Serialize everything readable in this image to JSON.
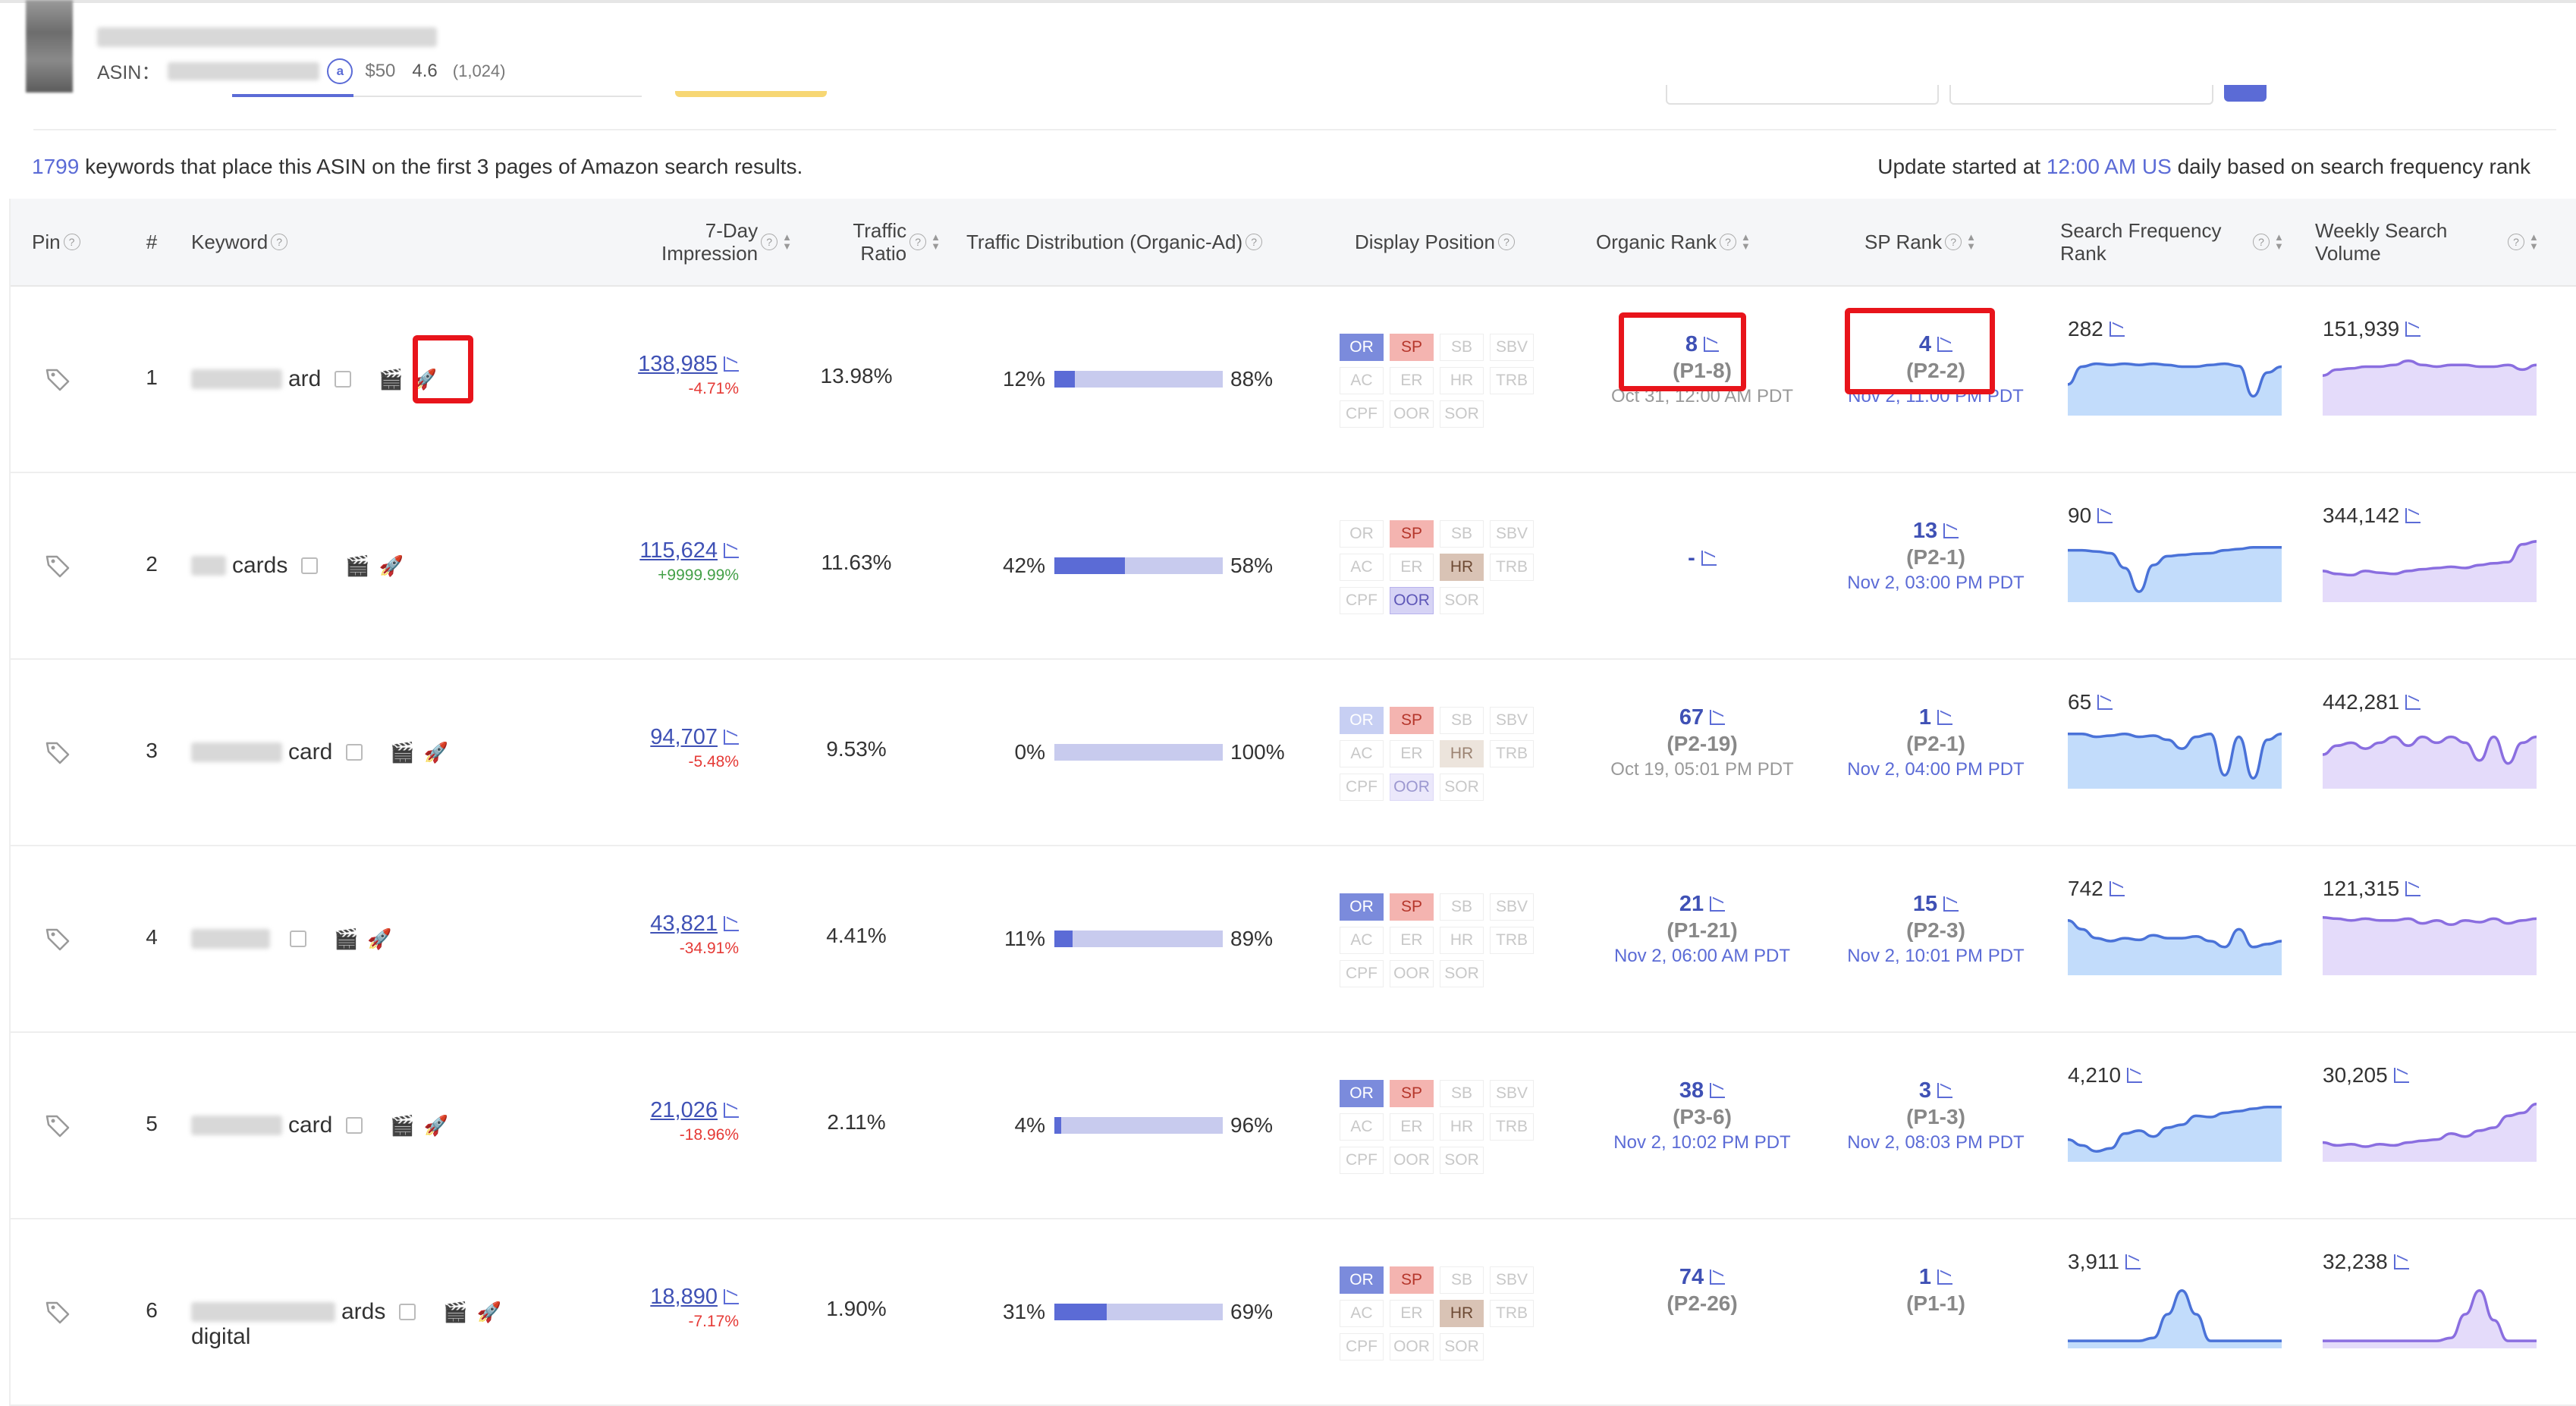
{
  "product": {
    "asin_label": "ASIN：",
    "amazon_icon": "a",
    "price": "$50",
    "rating": "4.6",
    "reviews": "(1,024)"
  },
  "summary": {
    "count": "1799",
    "text": " keywords that place this ASIN on the first 3 pages of Amazon search results.",
    "update_prefix": "Update started at ",
    "update_time": "12:00 AM US",
    "update_suffix": " daily based on search frequency rank"
  },
  "columns": {
    "pin": "Pin",
    "num": "#",
    "keyword": "Keyword",
    "impression": "7-Day Impression",
    "traffic_ratio": "Traffic Ratio",
    "distribution": "Traffic Distribution (Organic-Ad)",
    "display": "Display Position",
    "organic_rank": "Organic Rank",
    "sp_rank": "SP Rank",
    "sfr": "Search Frequency Rank",
    "wsv": "Weekly Search Volume"
  },
  "badge_labels": [
    "OR",
    "SP",
    "SB",
    "SBV",
    "AC",
    "ER",
    "HR",
    "TRB",
    "CPF",
    "OOR",
    "SOR"
  ],
  "rows": [
    {
      "num": "1",
      "kw_tail": "ard",
      "impression": "138,985",
      "change": "-4.71%",
      "change_dir": "neg",
      "ratio": "13.98%",
      "org": "12%",
      "ad": "88%",
      "org_frac": 0.12,
      "badges": {
        "OR": "OR",
        "SP": "SP",
        "HR": "",
        "OOR": ""
      },
      "organic": {
        "v": "8",
        "p": "(P1-8)",
        "d": "Oct 31, 12:00 AM PDT",
        "dc": "gray"
      },
      "sp": {
        "v": "4",
        "p": "(P2-2)",
        "d": "Nov 2, 11:00 PM PDT",
        "dc": "blue"
      },
      "sfr": "282",
      "wsv": "151,939",
      "sfr_series": [
        0.55,
        0.25,
        0.2,
        0.22,
        0.2,
        0.22,
        0.2,
        0.22,
        0.25,
        0.25,
        0.22,
        0.2,
        0.24,
        0.75,
        0.35,
        0.25
      ],
      "wsv_series": [
        0.4,
        0.3,
        0.28,
        0.25,
        0.25,
        0.22,
        0.15,
        0.22,
        0.25,
        0.22,
        0.22,
        0.25,
        0.25,
        0.22,
        0.3,
        0.22
      ]
    },
    {
      "num": "2",
      "kw_tail": "cards",
      "impression": "115,624",
      "change": "+9999.99%",
      "change_dir": "pos",
      "ratio": "11.63%",
      "org": "42%",
      "ad": "58%",
      "org_frac": 0.42,
      "badges": {
        "OR": "",
        "SP": "SP",
        "HR": "HR",
        "OOR": "OOR"
      },
      "organic": {
        "v": "-",
        "p": "",
        "d": "",
        "dc": "gray"
      },
      "sp": {
        "v": "13",
        "p": "(P2-1)",
        "d": "Nov 2, 03:00 PM PDT",
        "dc": "blue"
      },
      "sfr": "90",
      "wsv": "344,142",
      "sfr_series": [
        0.2,
        0.2,
        0.22,
        0.25,
        0.5,
        0.9,
        0.45,
        0.3,
        0.28,
        0.26,
        0.25,
        0.2,
        0.18,
        0.15,
        0.15,
        0.15
      ],
      "wsv_series": [
        0.55,
        0.6,
        0.62,
        0.55,
        0.58,
        0.6,
        0.55,
        0.52,
        0.5,
        0.48,
        0.5,
        0.45,
        0.42,
        0.4,
        0.1,
        0.05
      ]
    },
    {
      "num": "3",
      "kw_tail": "card",
      "impression": "94,707",
      "change": "-5.48%",
      "change_dir": "neg",
      "ratio": "9.53%",
      "org": "0%",
      "ad": "100%",
      "org_frac": 0.0,
      "badges": {
        "OR": "ORl",
        "SP": "SP",
        "HR": "HRl",
        "OOR": "OORl"
      },
      "organic": {
        "v": "67",
        "p": "(P2-19)",
        "d": "Oct 19, 05:01 PM PDT",
        "dc": "gray"
      },
      "sp": {
        "v": "1",
        "p": "(P2-1)",
        "d": "Nov 2, 04:00 PM PDT",
        "dc": "blue"
      },
      "sfr": "65",
      "wsv": "442,281",
      "sfr_series": [
        0.15,
        0.15,
        0.2,
        0.18,
        0.15,
        0.2,
        0.18,
        0.25,
        0.4,
        0.2,
        0.15,
        0.85,
        0.2,
        0.9,
        0.25,
        0.15
      ],
      "wsv_series": [
        0.5,
        0.35,
        0.3,
        0.4,
        0.3,
        0.2,
        0.35,
        0.2,
        0.3,
        0.2,
        0.3,
        0.6,
        0.2,
        0.65,
        0.3,
        0.2
      ]
    },
    {
      "num": "4",
      "kw_tail": "",
      "impression": "43,821",
      "change": "-34.91%",
      "change_dir": "neg",
      "ratio": "4.41%",
      "org": "11%",
      "ad": "89%",
      "org_frac": 0.11,
      "badges": {
        "OR": "OR",
        "SP": "SP",
        "HR": "",
        "OOR": ""
      },
      "organic": {
        "v": "21",
        "p": "(P1-21)",
        "d": "Nov 2, 06:00 AM PDT",
        "dc": "blue"
      },
      "sp": {
        "v": "15",
        "p": "(P2-3)",
        "d": "Nov 2, 10:01 PM PDT",
        "dc": "blue"
      },
      "sfr": "742",
      "wsv": "121,315",
      "sfr_series": [
        0.15,
        0.3,
        0.45,
        0.5,
        0.45,
        0.48,
        0.4,
        0.45,
        0.45,
        0.42,
        0.5,
        0.6,
        0.3,
        0.6,
        0.55,
        0.5
      ],
      "wsv_series": [
        0.1,
        0.12,
        0.15,
        0.12,
        0.15,
        0.15,
        0.12,
        0.2,
        0.15,
        0.22,
        0.15,
        0.18,
        0.12,
        0.2,
        0.15,
        0.12
      ]
    },
    {
      "num": "5",
      "kw_tail": "card",
      "impression": "21,026",
      "change": "-18.96%",
      "change_dir": "neg",
      "ratio": "2.11%",
      "org": "4%",
      "ad": "96%",
      "org_frac": 0.04,
      "badges": {
        "OR": "OR",
        "SP": "SP",
        "HR": "",
        "OOR": ""
      },
      "organic": {
        "v": "38",
        "p": "(P3-6)",
        "d": "Nov 2, 10:02 PM PDT",
        "dc": "blue"
      },
      "sp": {
        "v": "3",
        "p": "(P1-3)",
        "d": "Nov 2, 08:03 PM PDT",
        "dc": "blue"
      },
      "sfr": "4,210",
      "wsv": "30,205",
      "sfr_series": [
        0.7,
        0.8,
        0.9,
        0.85,
        0.6,
        0.55,
        0.65,
        0.5,
        0.45,
        0.3,
        0.32,
        0.25,
        0.22,
        0.18,
        0.15,
        0.15
      ],
      "wsv_series": [
        0.75,
        0.8,
        0.78,
        0.82,
        0.78,
        0.8,
        0.75,
        0.72,
        0.7,
        0.6,
        0.65,
        0.55,
        0.5,
        0.3,
        0.25,
        0.1
      ]
    },
    {
      "num": "6",
      "kw_tail": "ards",
      "kw_second": "digital",
      "impression": "18,890",
      "change": "-7.17%",
      "change_dir": "neg",
      "ratio": "1.90%",
      "org": "31%",
      "ad": "69%",
      "org_frac": 0.31,
      "badges": {
        "OR": "OR",
        "SP": "SP",
        "HR": "HR",
        "OOR": ""
      },
      "organic": {
        "v": "74",
        "p": "(P2-26)",
        "d": "",
        "dc": "gray"
      },
      "sp": {
        "v": "1",
        "p": "(P1-1)",
        "d": "",
        "dc": "blue"
      },
      "sfr": "3,911",
      "wsv": "32,238",
      "sfr_series": [
        0.95,
        0.95,
        0.95,
        0.95,
        0.95,
        0.95,
        0.9,
        0.5,
        0.1,
        0.5,
        0.95,
        0.95,
        0.95,
        0.95,
        0.95,
        0.95
      ],
      "wsv_series": [
        0.95,
        0.95,
        0.95,
        0.95,
        0.95,
        0.95,
        0.95,
        0.95,
        0.95,
        0.9,
        0.5,
        0.1,
        0.6,
        0.95,
        0.95,
        0.95
      ]
    }
  ]
}
